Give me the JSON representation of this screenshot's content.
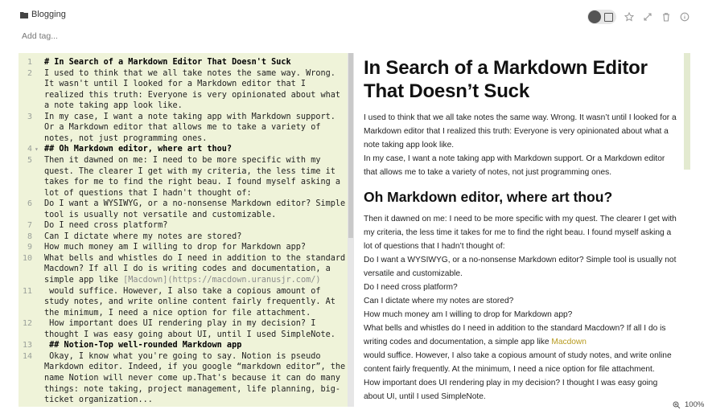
{
  "header": {
    "notebook": "Blogging",
    "add_tag": "Add tag..."
  },
  "editor": {
    "lines": [
      {
        "n": "1",
        "text": "# In Search of a Markdown Editor That Doesn't Suck",
        "heading": true
      },
      {
        "n": "2",
        "text": "I used to think that we all take notes the same way. Wrong."
      },
      {
        "n": "",
        "text": "It wasn't until I looked for a Markdown editor that I"
      },
      {
        "n": "",
        "text": "realized this truth: Everyone is very opinionated about what"
      },
      {
        "n": "",
        "text": "a note taking app look like."
      },
      {
        "n": "3",
        "text": "In my case, I want a note taking app with Markdown support."
      },
      {
        "n": "",
        "text": "Or a Markdown editor that allows me to take a variety of"
      },
      {
        "n": "",
        "text": "notes, not just programming ones."
      },
      {
        "n": "4",
        "text": "## Oh Markdown editor, where art thou?",
        "heading": true,
        "fold": true
      },
      {
        "n": "5",
        "text": "Then it dawned on me: I need to be more specific with my"
      },
      {
        "n": "",
        "text": "quest. The clearer I get with my criteria, the less time it"
      },
      {
        "n": "",
        "text": "takes for me to find the right beau. I found myself asking a"
      },
      {
        "n": "",
        "text": "lot of questions that I hadn't thought of:"
      },
      {
        "n": "6",
        "text": "Do I want a WYSIWYG, or a no-nonsense Markdown editor? Simple"
      },
      {
        "n": "",
        "text": "tool is usually not versatile and customizable."
      },
      {
        "n": "7",
        "text": "Do I need cross platform?"
      },
      {
        "n": "8",
        "text": "Can I dictate where my notes are stored?"
      },
      {
        "n": "9",
        "text": "How much money am I willing to drop for Markdown app?"
      },
      {
        "n": "10",
        "text": "What bells and whistles do I need in addition to the standard"
      },
      {
        "n": "",
        "text": "Macdown? If all I do is writing codes and documentation, a"
      },
      {
        "n": "",
        "text": "simple app like ",
        "link": "[Macdown](https://macdown.uranusjr.com/)"
      },
      {
        "n": "11",
        "text": " would suffice. However, I also take a copious amount of"
      },
      {
        "n": "",
        "text": "study notes, and write online content fairly frequently. At"
      },
      {
        "n": "",
        "text": "the minimum, I need a nice option for file attachment."
      },
      {
        "n": "12",
        "text": " How important does UI rendering play in my decision? I"
      },
      {
        "n": "",
        "text": "thought I was easy going about UI, until I used SimpleNote."
      },
      {
        "n": "13",
        "text": " ## Notion-Top well-rounded Markdown app",
        "heading": true
      },
      {
        "n": "14",
        "text": " Okay, I know what you're going to say. Notion is pseudo"
      },
      {
        "n": "",
        "text": "Markdown editor. Indeed, if you google “markdown editor”, the"
      },
      {
        "n": "",
        "text": "name Notion will never come up.That's because it can do many"
      },
      {
        "n": "",
        "text": "things: note taking, project management, life planning, big-"
      },
      {
        "n": "",
        "text": "ticket organization..."
      }
    ]
  },
  "preview": {
    "title_line1": "In Search of a Markdown Editor",
    "title_line2": "That Doesn’t Suck",
    "para1": [
      "I used to think that we all take notes the same way. Wrong. It wasn’t until I looked for a",
      "Markdown editor that I realized this truth: Everyone is very opinionated about what a",
      "note taking app look like.",
      "In my case, I want a note taking app with Markdown support. Or a Markdown editor",
      "that allows me to take a variety of notes, not just programming ones."
    ],
    "h2": "Oh Markdown editor, where art thou?",
    "para2": [
      "Then it dawned on me: I need to be more specific with my quest. The clearer I get with",
      "my criteria, the less time it takes for me to find the right beau. I found myself asking a",
      "lot of questions that I hadn’t thought of:",
      "Do I want a WYSIWYG, or a no-nonsense Markdown editor? Simple tool is usually not",
      "versatile and customizable.",
      "Do I need cross platform?",
      "Can I dictate where my notes are stored?",
      "How much money am I willing to drop for Markdown app?",
      "What bells and whistles do I need in addition to the standard Macdown? If all I do is"
    ],
    "para2_link_prefix": "writing codes and documentation, a simple app like ",
    "para2_link": "Macdown",
    "para3": [
      "would suffice. However, I also take a copious amount of study notes, and write online",
      "content fairly frequently. At the minimum, I need a nice option for file attachment.",
      "How important does UI rendering play in my decision? I thought I was easy going",
      "about UI, until I used SimpleNote."
    ]
  },
  "status": {
    "zoom": "100%"
  },
  "colors": {
    "editor_bg": "#eff3d9",
    "link": "#b79a1f"
  }
}
